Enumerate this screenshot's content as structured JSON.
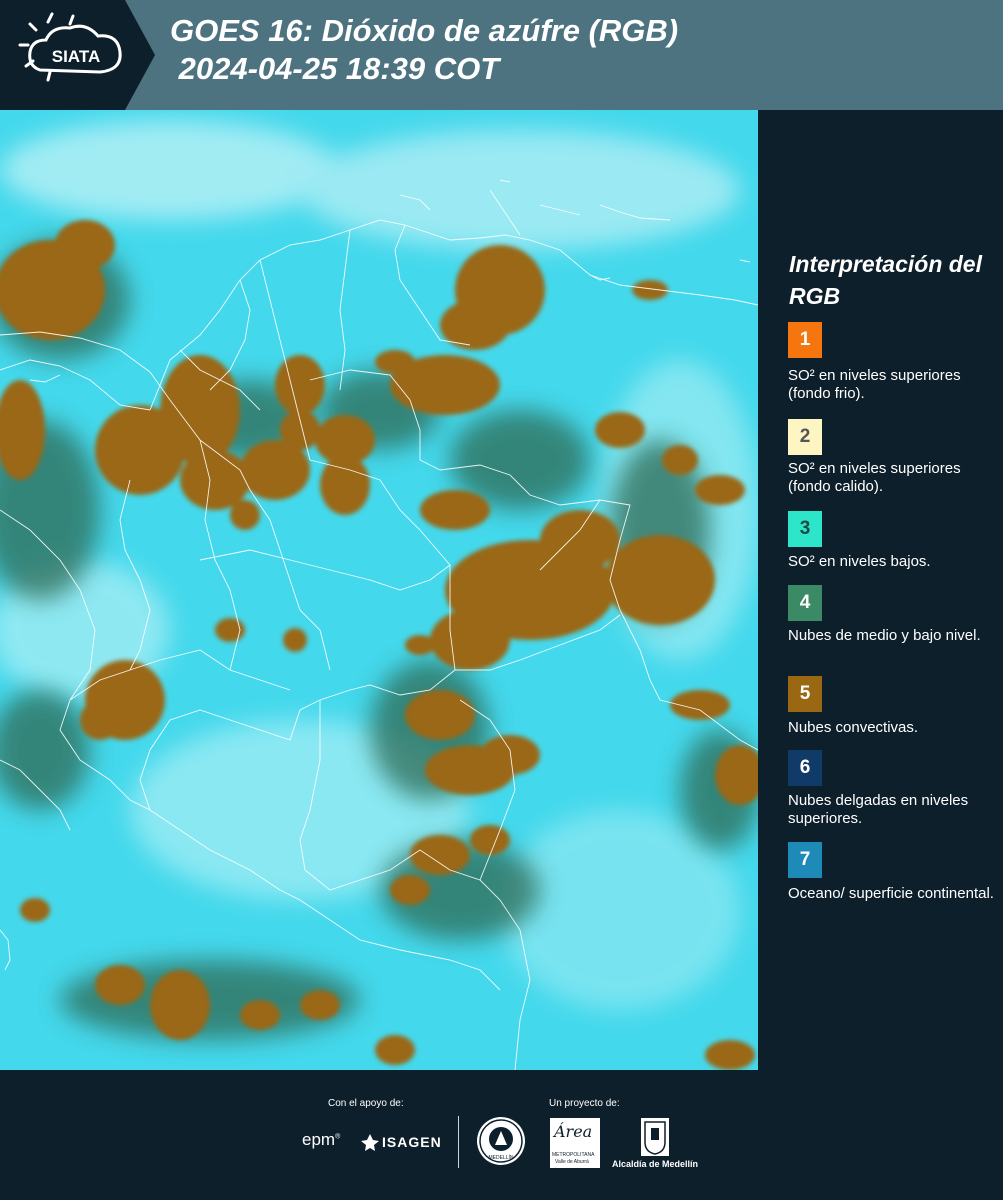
{
  "header": {
    "logo_text": "SIATA",
    "title_line1": "GOES 16: Dióxido de azúfre (RGB)",
    "title_line2": " 2024-04-25 18:39 COT"
  },
  "legend": {
    "title": "Interpretación del RGB",
    "items": [
      {
        "num": "1",
        "color": "#f5760e",
        "text": "SO² en niveles superiores (fondo frio)."
      },
      {
        "num": "2",
        "color": "#fdf5c2",
        "text": "SO² en niveles superiores (fondo calido)."
      },
      {
        "num": "3",
        "color": "#2de5c8",
        "text": "SO² en niveles bajos."
      },
      {
        "num": "4",
        "color": "#3b8a66",
        "text": "Nubes de medio y bajo nivel."
      },
      {
        "num": "5",
        "color": "#9a6813",
        "text": "Nubes convectivas."
      },
      {
        "num": "6",
        "color": "#103a67",
        "text": "Nubes delgadas en niveles superiores."
      },
      {
        "num": "7",
        "color": "#1e8ab8",
        "text": "Oceano/ superficie continental."
      }
    ]
  },
  "footer": {
    "support_label": "Con el apoyo de:",
    "project_label": "Un proyecto de:",
    "epm": "epm",
    "isagen": "ISAGEN",
    "area_script": "Área",
    "area_sub1": "METROPOLITANA",
    "area_sub2": "Valle de Aburrá",
    "alcaldia": "Alcaldía de Medellín",
    "seal_text": "MEDELLÍN"
  },
  "colors": {
    "header_bg": "#4d7380",
    "logo_bg": "#0d1f2b",
    "page_bg": "#0d1f2b",
    "map_background": "#41d8ec",
    "cloud_convective": "#9a6813",
    "cloud_mid_low": "#2f6a54",
    "boundary_lines": "#ffffff"
  }
}
